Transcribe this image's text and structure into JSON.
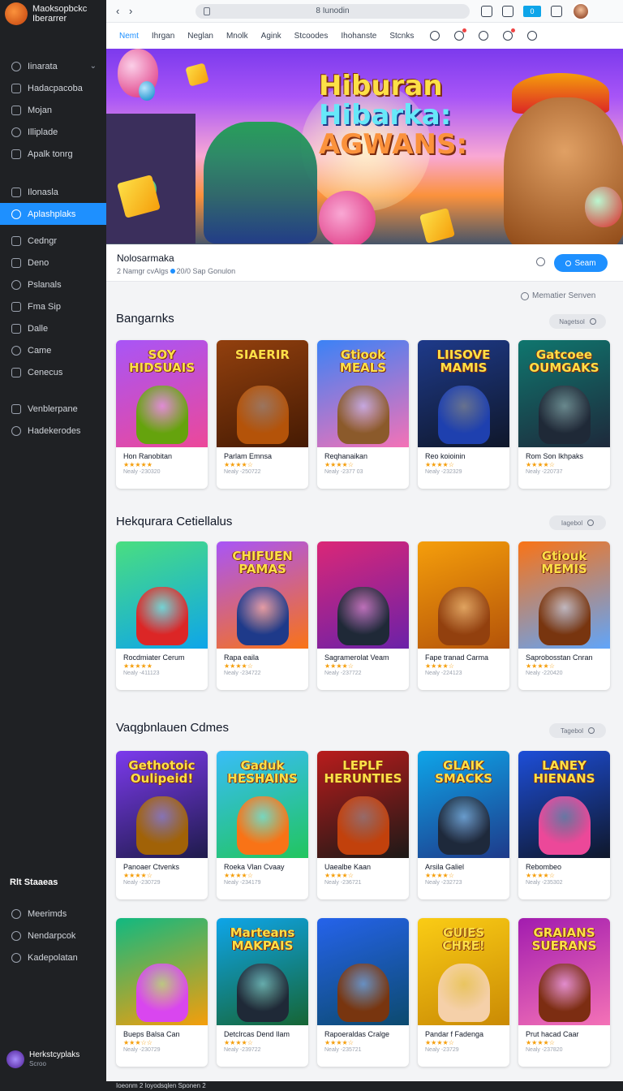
{
  "app": {
    "title_line1": "Maoksopbckc",
    "title_line2": "Iberarrer"
  },
  "sidebar": {
    "items": [
      {
        "label": "Iinarata",
        "icon": "home-icon",
        "chevron": "⌄"
      },
      {
        "label": "Hadacpacoba",
        "icon": "pencil-icon"
      },
      {
        "label": "Mojan",
        "icon": "triangle-icon"
      },
      {
        "label": "Illiplade",
        "icon": "bars-icon"
      },
      {
        "label": "Apalk tonrg",
        "icon": "window-icon"
      },
      {
        "label": "Ilonasla",
        "icon": "globe-icon"
      },
      {
        "label": "Aplashplaks",
        "icon": "bookmark-icon",
        "active": true
      },
      {
        "label": "Cedngr",
        "icon": "circle-icon"
      },
      {
        "label": "Deno",
        "icon": "refresh-icon"
      },
      {
        "label": "Pslanals",
        "icon": "list-icon"
      },
      {
        "label": "Fma Sip",
        "icon": "image-icon"
      },
      {
        "label": "Dalle",
        "icon": "info-icon"
      },
      {
        "label": "Came",
        "icon": "gamepad-icon"
      },
      {
        "label": "Cenecus",
        "icon": "clock-icon"
      },
      {
        "label": "Venblerpane",
        "icon": "grid-icon"
      },
      {
        "label": "Hadekerodes",
        "icon": "settings-icon"
      }
    ],
    "group_title": "Rlt Staaeas",
    "group_items": [
      {
        "label": "Meerimds",
        "icon": "plus-icon"
      },
      {
        "label": "Nendarpcok",
        "icon": "book-icon"
      },
      {
        "label": "Kadepolatan",
        "icon": "shield-icon"
      }
    ],
    "footer_title": "Herkstcyplaks",
    "footer_sub": "Scroo"
  },
  "topbar": {
    "back": "‹ ›",
    "url": "8 Iunodin",
    "badge": "0"
  },
  "tabs": [
    "Nemt",
    "Ihrgan",
    "Neglan",
    "Mnolk",
    "Agink",
    "Stcoodes",
    "Ihohanste",
    "Stcnks"
  ],
  "hero": {
    "line1": "Hiburan",
    "line2": "Hibarka:",
    "line3": "AGWANS:"
  },
  "infobar": {
    "title": "Nolosarmaka",
    "sub_left": "2 Namgr cvAlgs",
    "sub_right": "20/0 Sap Gonulon",
    "search_button": "Seam"
  },
  "server_note": "Mematier Senven",
  "sections": [
    {
      "title": "Bangarnks",
      "see_all": "Nagetsol",
      "cards": [
        {
          "title": "SOY HIDSUAIS",
          "name": "Hon Ranobitan",
          "stars": "★★★★★",
          "meta": "Nealy -230320",
          "bg": "linear-gradient(160deg,#a855f7,#ec4899)",
          "char": "#65a30d"
        },
        {
          "title": "SIAERIR",
          "name": "Parlam Emnsa",
          "stars": "★★★★☆",
          "meta": "Nealy -250722",
          "bg": "linear-gradient(160deg,#92400e,#451a03)",
          "char": "#b45309"
        },
        {
          "title": "Gtiook MEALS",
          "name": "Reqhanaikan",
          "stars": "★★★★☆",
          "meta": "Nealy -2377 03",
          "bg": "linear-gradient(160deg,#3b82f6,#f472b6)",
          "char": "#8b5a2b"
        },
        {
          "title": "LIISOVE MAMIS",
          "name": "Reo koioinin",
          "stars": "★★★★☆",
          "meta": "Nealy -232329",
          "bg": "linear-gradient(160deg,#1e3a8a,#0f172a)",
          "char": "#1e40af"
        },
        {
          "title": "Gatcoee OUMGAKS",
          "name": "Rom Son Ikhpaks",
          "stars": "★★★★☆",
          "meta": "Nealy -220737",
          "bg": "linear-gradient(160deg,#0f766e,#1e293b)",
          "char": "#1f2937"
        }
      ]
    },
    {
      "title": "Hekqurara Cetiellalus",
      "see_all": "Iagebol",
      "cards": [
        {
          "title": "",
          "name": "Rocdmiater Cerum",
          "stars": "★★★★★",
          "meta": "Nealy -411123",
          "bg": "linear-gradient(160deg,#4ade80,#0ea5e9)",
          "char": "#dc2626"
        },
        {
          "title": "CHIFUEN PAMAS",
          "name": "Rapa eaila",
          "stars": "★★★★☆",
          "meta": "Nealy -234722",
          "bg": "linear-gradient(160deg,#a855f7,#f97316)",
          "char": "#1e3a8a"
        },
        {
          "title": "",
          "name": "Sagramerolat Veam",
          "stars": "★★★★☆",
          "meta": "Nealy -237722",
          "bg": "linear-gradient(160deg,#db2777,#6b21a8)",
          "char": "#1f2937"
        },
        {
          "title": "",
          "name": "Fape tranad Carma",
          "stars": "★★★★☆",
          "meta": "Nealy -224123",
          "bg": "linear-gradient(160deg,#f59e0b,#b45309)",
          "char": "#92400e"
        },
        {
          "title": "Gtiouk MEMIS",
          "name": "Saprobosstan Cnran",
          "stars": "★★★★☆",
          "meta": "Nealy -220420",
          "bg": "linear-gradient(160deg,#f97316,#60a5fa)",
          "char": "#78350f"
        }
      ]
    },
    {
      "title": "Vaqgbnlauen Cdmes",
      "see_all": "Tagebol",
      "cards": [
        {
          "title": "Gethotoic Oulipeid!",
          "name": "Panoaer Ctvenks",
          "stars": "★★★★☆",
          "meta": "Nealy -230729",
          "bg": "linear-gradient(160deg,#7c3aed,#1e1b4b)",
          "char": "#a16207"
        },
        {
          "title": "Gaduk HESHAINS",
          "name": "Roeka Vlan Cvaay",
          "stars": "★★★★☆",
          "meta": "Nealy -234179",
          "bg": "linear-gradient(160deg,#38bdf8,#22c55e)",
          "char": "#f97316"
        },
        {
          "title": "LEPLF HERUNTIES",
          "name": "Uaealbe Kaan",
          "stars": "★★★★☆",
          "meta": "Nealy -236721",
          "bg": "linear-gradient(160deg,#b91c1c,#1c1917)",
          "char": "#c2410c"
        },
        {
          "title": "GLAIK SMACKS",
          "name": "Arsila Galiel",
          "stars": "★★★★☆",
          "meta": "Nealy -232723",
          "bg": "linear-gradient(160deg,#0ea5e9,#1e3a8a)",
          "char": "#1e293b"
        },
        {
          "title": "LANEY HIENANS",
          "name": "Rebombeo",
          "stars": "★★★★☆",
          "meta": "Nealy -235302",
          "bg": "linear-gradient(160deg,#1d4ed8,#0f172a)",
          "char": "#ec4899"
        }
      ]
    },
    {
      "title": "",
      "see_all": "",
      "cards": [
        {
          "title": "",
          "name": "Bueps Balsa Can",
          "stars": "★★★☆☆",
          "meta": "Nealy -230729",
          "bg": "linear-gradient(160deg,#10b981,#f59e0b)",
          "char": "#d946ef"
        },
        {
          "title": "Marteans MAKPAIS",
          "name": "Detclrcas Dend Ilam",
          "stars": "★★★★☆",
          "meta": "Nealy -239722",
          "bg": "linear-gradient(160deg,#0ea5e9,#166534)",
          "char": "#1f2937"
        },
        {
          "title": "",
          "name": "Rapoeraldas Cralge",
          "stars": "★★★★☆",
          "meta": "Nealy -235721",
          "bg": "linear-gradient(160deg,#2563eb,#0c4a6e)",
          "char": "#78350f"
        },
        {
          "title": "GUIES CHRE!",
          "name": "Pandar f Fadenga",
          "stars": "★★★★☆",
          "meta": "Nealy -23729",
          "bg": "linear-gradient(160deg,#facc15,#ca8a04)",
          "char": "#f5d0a9"
        },
        {
          "title": "GRAIANS SUERANS",
          "name": "Prut hacad Caar",
          "stars": "★★★★☆",
          "meta": "Nealy -237820",
          "bg": "linear-gradient(160deg,#a21caf,#f472b6)",
          "char": "#7c2d12"
        }
      ]
    }
  ],
  "bottom_strip": "Ioeonm   2   Ioyodsqlen Sponen   2"
}
